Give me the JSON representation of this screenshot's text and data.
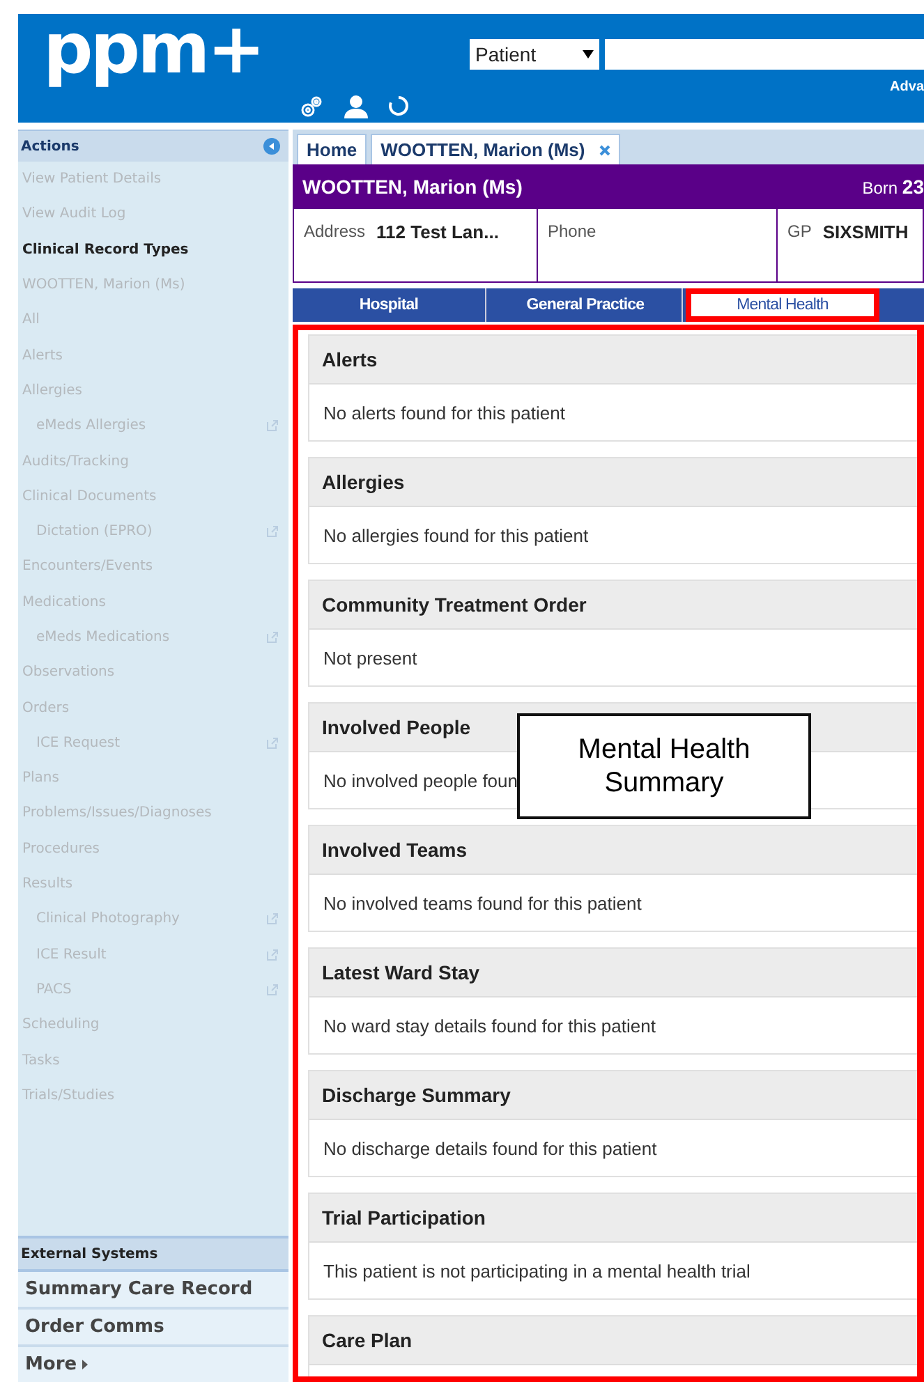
{
  "header": {
    "logo": "ppm+",
    "search_type": "Patient",
    "search_link": "Adva"
  },
  "sidebar": {
    "title": "Actions",
    "items": [
      {
        "label": "View Patient Details",
        "kind": "link"
      },
      {
        "label": "View Audit Log",
        "kind": "link"
      },
      {
        "label": "Clinical Record Types",
        "kind": "heading"
      },
      {
        "label": "WOOTTEN, Marion (Ms)",
        "kind": "link"
      },
      {
        "label": "All",
        "kind": "link"
      },
      {
        "label": "Alerts",
        "kind": "link"
      },
      {
        "label": "Allergies",
        "kind": "link",
        "children": [
          {
            "label": "eMeds Allergies",
            "external": true
          }
        ]
      },
      {
        "label": "Audits/Tracking",
        "kind": "link"
      },
      {
        "label": "Clinical Documents",
        "kind": "link",
        "children": [
          {
            "label": "Dictation (EPRO)",
            "external": true
          }
        ]
      },
      {
        "label": "Encounters/Events",
        "kind": "link"
      },
      {
        "label": "Medications",
        "kind": "link",
        "children": [
          {
            "label": "eMeds Medications",
            "external": true
          }
        ]
      },
      {
        "label": "Observations",
        "kind": "link"
      },
      {
        "label": "Orders",
        "kind": "link",
        "children": [
          {
            "label": "ICE Request",
            "external": true
          }
        ]
      },
      {
        "label": "Plans",
        "kind": "link"
      },
      {
        "label": "Problems/Issues/Diagnoses",
        "kind": "link"
      },
      {
        "label": "Procedures",
        "kind": "link"
      },
      {
        "label": "Results",
        "kind": "link",
        "children": [
          {
            "label": "Clinical Photography",
            "external": true
          },
          {
            "label": "ICE Result",
            "external": true
          },
          {
            "label": "PACS",
            "external": true
          }
        ]
      },
      {
        "label": "Scheduling",
        "kind": "link"
      },
      {
        "label": "Tasks",
        "kind": "link"
      },
      {
        "label": "Trials/Studies",
        "kind": "link"
      }
    ],
    "external_title": "External Systems",
    "external_items": [
      "Summary Care Record",
      "Order Comms"
    ],
    "more": "More"
  },
  "tabs": [
    {
      "label": "Home",
      "closable": false
    },
    {
      "label": "WOOTTEN, Marion (Ms)",
      "closable": true
    }
  ],
  "patient": {
    "name": "WOOTTEN, Marion (Ms)",
    "born_label": "Born",
    "born_value": "23",
    "fields": [
      {
        "label": "Address",
        "value": "112 Test Lan..."
      },
      {
        "label": "Phone"
      },
      {
        "label": "GP",
        "value": "SIXSMITH"
      }
    ]
  },
  "record_tabs": [
    {
      "label": "Hospital",
      "selected": false
    },
    {
      "label": "General Practice",
      "selected": false
    },
    {
      "label": "Mental Health",
      "selected": true
    }
  ],
  "sections": [
    {
      "title": "Alerts",
      "text": "No alerts found for this patient"
    },
    {
      "title": "Allergies",
      "text": "No allergies found for this patient"
    },
    {
      "title": "Community Treatment Order",
      "text": "Not present"
    },
    {
      "title": "Involved People",
      "text": "No involved people foun"
    },
    {
      "title": "Involved Teams",
      "text": "No involved teams found for this patient"
    },
    {
      "title": "Latest Ward Stay",
      "text": "No ward stay details found for this patient"
    },
    {
      "title": "Discharge Summary",
      "text": "No discharge details found for this patient"
    },
    {
      "title": "Trial Participation",
      "text": "This patient is not participating in a mental health trial"
    },
    {
      "title": "Care Plan"
    }
  ],
  "callout": "Mental Health Summary"
}
